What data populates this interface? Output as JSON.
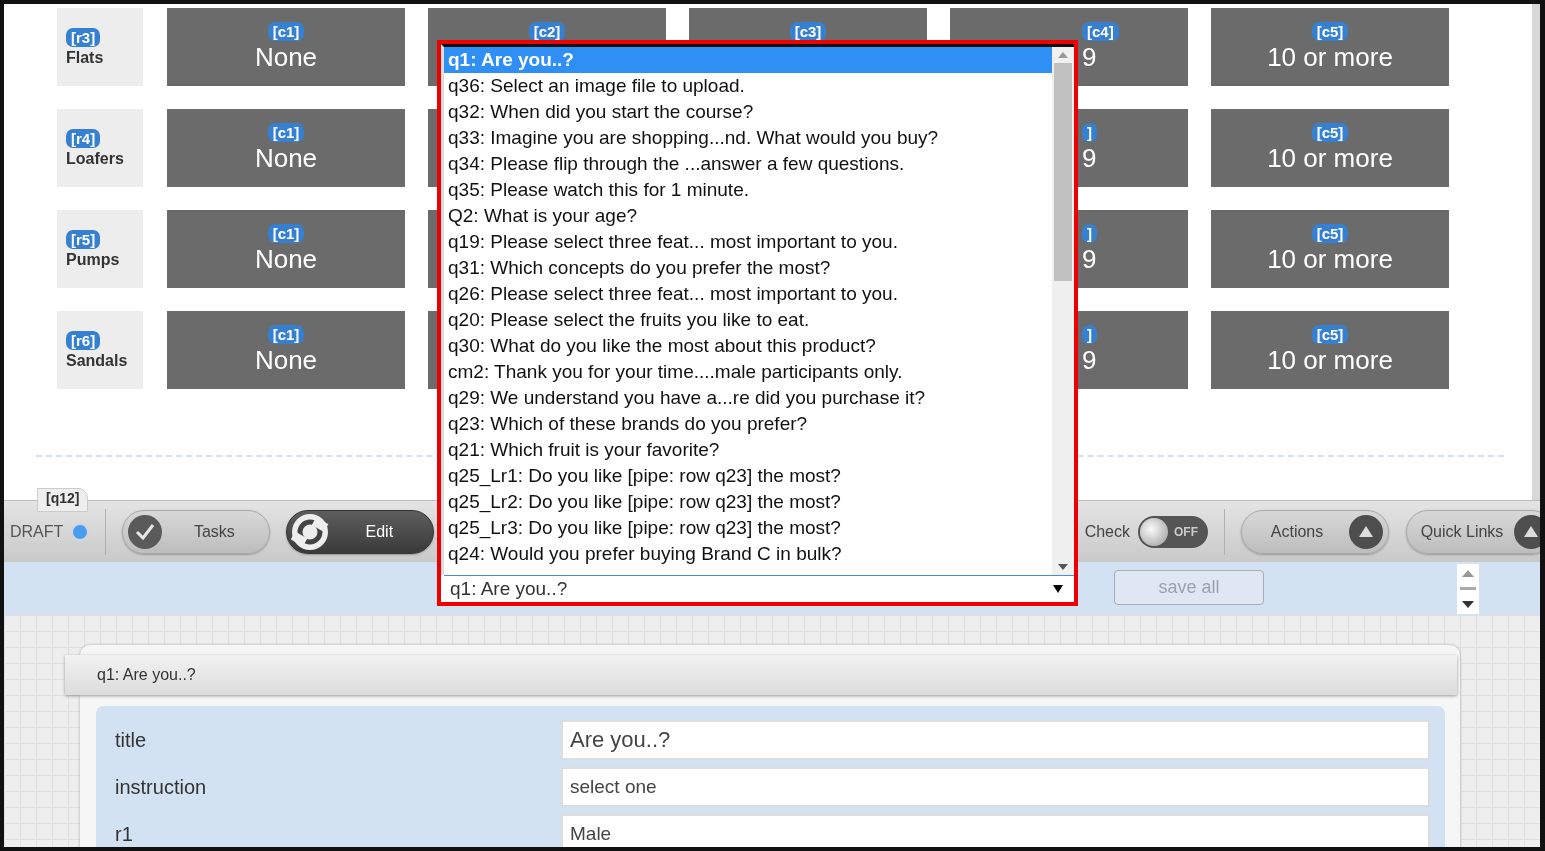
{
  "grid": {
    "rows": [
      {
        "badge": "[r3]",
        "label": "Flats",
        "cells": [
          {
            "kind": "full",
            "badge": "[c1]",
            "value": "None"
          },
          {
            "kind": "top",
            "badge": "[c2]"
          },
          {
            "kind": "top",
            "badge": "[c3]"
          },
          {
            "kind": "partial",
            "badge": "[c4]",
            "value": "9"
          },
          {
            "kind": "full",
            "badge": "[c5]",
            "value": "10 or more"
          }
        ]
      },
      {
        "badge": "[r4]",
        "label": "Loafers",
        "cells": [
          {
            "kind": "full",
            "badge": "[c1]",
            "value": "None"
          },
          {
            "kind": "hidden"
          },
          "",
          {
            "kind": "partial",
            "badge": "]",
            "value": "9"
          },
          {
            "kind": "full",
            "badge": "[c5]",
            "value": "10 or more"
          }
        ]
      },
      {
        "badge": "[r5]",
        "label": "Pumps",
        "cells": [
          {
            "kind": "full",
            "badge": "[c1]",
            "value": "None"
          },
          {
            "kind": "hidden"
          },
          "",
          {
            "kind": "partial",
            "badge": "]",
            "value": "9"
          },
          {
            "kind": "full",
            "badge": "[c5]",
            "value": "10 or more"
          }
        ]
      },
      {
        "badge": "[r6]",
        "label": "Sandals",
        "cells": [
          {
            "kind": "full",
            "badge": "[c1]",
            "value": "None"
          },
          {
            "kind": "hidden"
          },
          "",
          {
            "kind": "partial",
            "badge": "]",
            "value": "9"
          },
          {
            "kind": "full",
            "badge": "[c5]",
            "value": "10 or more"
          }
        ]
      }
    ]
  },
  "question_tab": "[q12]",
  "toolbar": {
    "status": "DRAFT",
    "buttons": [
      {
        "label": "Tasks",
        "kind": "check",
        "selected": false
      },
      {
        "label": "Edit",
        "kind": "wrench",
        "selected": true
      }
    ],
    "toggle": {
      "label": "Check",
      "on": false,
      "state_text": "OFF"
    },
    "menus": [
      {
        "label": "Actions"
      },
      {
        "label": "Quick Links"
      }
    ]
  },
  "save_button": {
    "label": "save all",
    "disabled": true
  },
  "dropdown": {
    "value": "q1: Are you..?",
    "options": [
      {
        "label": "q1: Are you..?",
        "selected": true
      },
      {
        "label": "q36: Select an image file to upload.",
        "selected": false
      },
      {
        "label": "q32: When did you start the course?",
        "selected": false
      },
      {
        "label": "q33: Imagine you are shopping...nd. What would you buy?",
        "selected": false
      },
      {
        "label": "q34: Please flip through the ...answer a few questions.",
        "selected": false
      },
      {
        "label": "q35: Please watch this for 1 minute.",
        "selected": false
      },
      {
        "label": "Q2: What is your age?",
        "selected": false
      },
      {
        "label": "q19: Please select three feat... most important to you.",
        "selected": false
      },
      {
        "label": "q31: Which concepts do you prefer the most?",
        "selected": false
      },
      {
        "label": "q26: Please select three feat... most important to you.",
        "selected": false
      },
      {
        "label": "q20: Please select the fruits you like to eat.",
        "selected": false
      },
      {
        "label": "q30: What do you like the most about this product?",
        "selected": false
      },
      {
        "label": "cm2: Thank you for your time....male participants only.",
        "selected": false
      },
      {
        "label": "q29: We understand you have a...re did you purchase it?",
        "selected": false
      },
      {
        "label": "q23: Which of these brands do you prefer?",
        "selected": false
      },
      {
        "label": "q21: Which fruit is your favorite?",
        "selected": false
      },
      {
        "label": "q25_Lr1: Do you like [pipe: row q23] the most?",
        "selected": false
      },
      {
        "label": "q25_Lr2: Do you like [pipe: row q23] the most?",
        "selected": false
      },
      {
        "label": "q25_Lr3: Do you like [pipe: row q23] the most?",
        "selected": false
      },
      {
        "label": "q24: Would you prefer buying Brand C in bulk?",
        "selected": false
      }
    ]
  },
  "editor": {
    "header": "q1: Are you..?",
    "fields": [
      {
        "label": "title",
        "value": "Are you..?"
      },
      {
        "label": "instruction",
        "value": "select one"
      },
      {
        "label": "r1",
        "value": "Male"
      }
    ]
  }
}
